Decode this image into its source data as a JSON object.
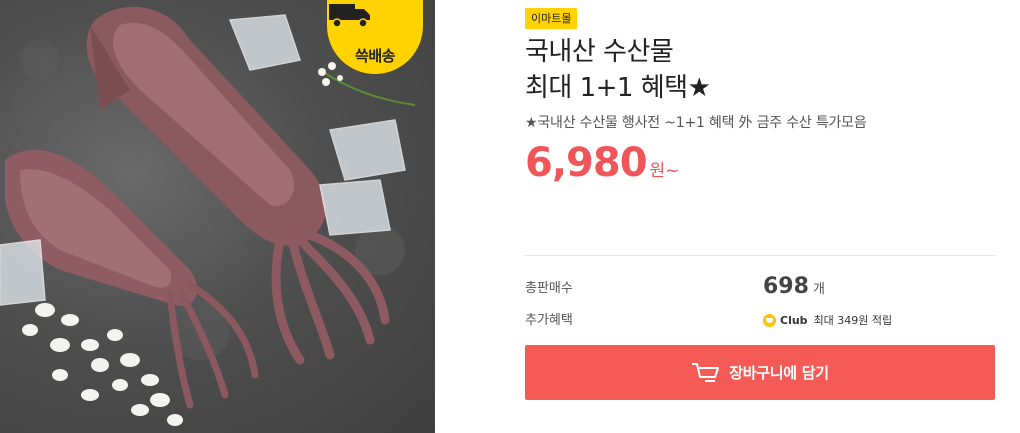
{
  "product_image": {
    "alt_subject": "squid",
    "badge": {
      "text": "쓱배송",
      "icon": "delivery-truck-icon",
      "color": "#ffd200"
    }
  },
  "product": {
    "store_tag": "이마트몰",
    "title_line1": "국내산 수산물",
    "title_line2": "최대 1+1 혜택★",
    "subtitle": "★국내산 수산물 행사전 ~1+1 혜택 外 금주 수산 특가모음",
    "price": "6,980",
    "price_unit": "원~"
  },
  "details": {
    "sold_label": "총판매수",
    "sold_value": "698",
    "sold_unit": "개",
    "benefit_label": "추가혜택",
    "club_label": "Club",
    "club_text": "최대 349원 적립"
  },
  "cart_button": {
    "label": "장바구니에 담기",
    "icon": "cart-icon"
  },
  "colors": {
    "accent": "#f45b57",
    "price": "#f0555a",
    "tag": "#ffd200"
  }
}
